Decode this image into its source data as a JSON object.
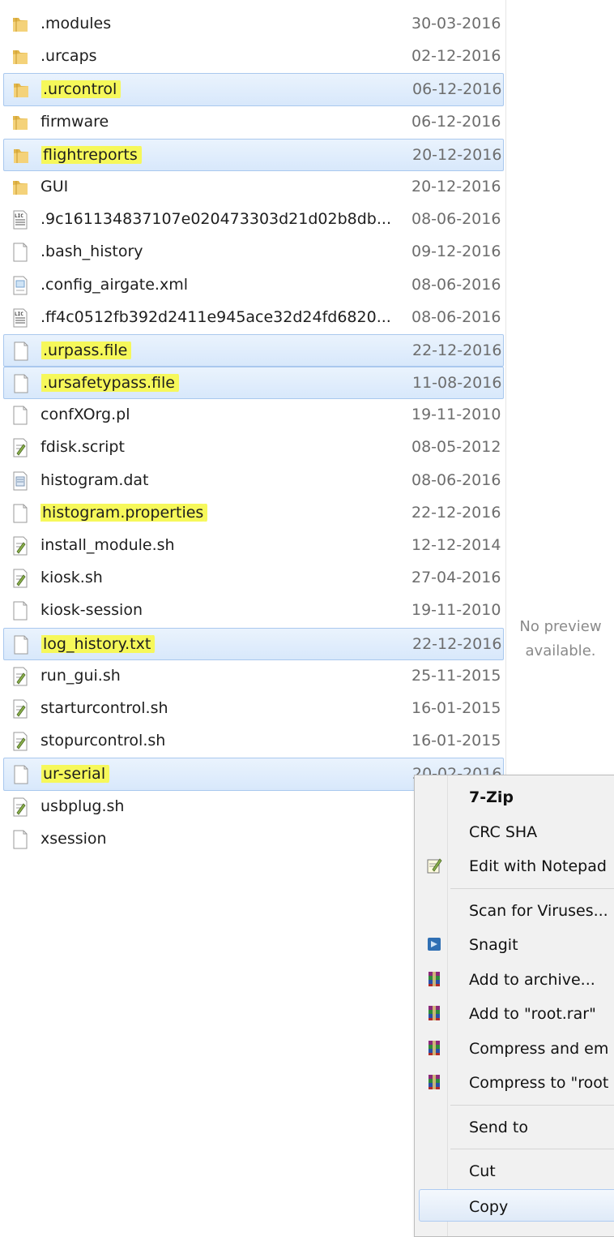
{
  "files": [
    {
      "name": ".modules",
      "date": "30-03-2016",
      "icon": "folder-icon",
      "selected": false,
      "highlighted": false
    },
    {
      "name": ".urcaps",
      "date": "02-12-2016",
      "icon": "folder-icon",
      "selected": false,
      "highlighted": false
    },
    {
      "name": ".urcontrol",
      "date": "06-12-2016",
      "icon": "folder-icon",
      "selected": true,
      "highlighted": true
    },
    {
      "name": "firmware",
      "date": "06-12-2016",
      "icon": "folder-icon",
      "selected": false,
      "highlighted": false
    },
    {
      "name": "flightreports",
      "date": "20-12-2016",
      "icon": "folder-icon",
      "selected": true,
      "highlighted": true
    },
    {
      "name": "GUI",
      "date": "20-12-2016",
      "icon": "folder-icon",
      "selected": false,
      "highlighted": false
    },
    {
      "name": ".9c161134837107e020473303d21d02b8db...",
      "date": "08-06-2016",
      "icon": "license-file-icon",
      "selected": false,
      "highlighted": false
    },
    {
      "name": ".bash_history",
      "date": "09-12-2016",
      "icon": "blank-file-icon",
      "selected": false,
      "highlighted": false
    },
    {
      "name": ".config_airgate.xml",
      "date": "08-06-2016",
      "icon": "xml-file-icon",
      "selected": false,
      "highlighted": false
    },
    {
      "name": ".ff4c0512fb392d2411e945ace32d24fd6820...",
      "date": "08-06-2016",
      "icon": "license-file-icon",
      "selected": false,
      "highlighted": false
    },
    {
      "name": ".urpass.file",
      "date": "22-12-2016",
      "icon": "blank-file-icon",
      "selected": true,
      "highlighted": true
    },
    {
      "name": ".ursafetypass.file",
      "date": "11-08-2016",
      "icon": "blank-file-icon",
      "selected": true,
      "highlighted": true
    },
    {
      "name": "confXOrg.pl",
      "date": "19-11-2010",
      "icon": "blank-file-icon",
      "selected": false,
      "highlighted": false
    },
    {
      "name": "fdisk.script",
      "date": "08-05-2012",
      "icon": "script-file-icon",
      "selected": false,
      "highlighted": false
    },
    {
      "name": "histogram.dat",
      "date": "08-06-2016",
      "icon": "data-file-icon",
      "selected": false,
      "highlighted": false
    },
    {
      "name": "histogram.properties",
      "date": "22-12-2016",
      "icon": "blank-file-icon",
      "selected": false,
      "highlighted": true
    },
    {
      "name": "install_module.sh",
      "date": "12-12-2014",
      "icon": "script-file-icon",
      "selected": false,
      "highlighted": false
    },
    {
      "name": "kiosk.sh",
      "date": "27-04-2016",
      "icon": "script-file-icon",
      "selected": false,
      "highlighted": false
    },
    {
      "name": "kiosk-session",
      "date": "19-11-2010",
      "icon": "blank-file-icon",
      "selected": false,
      "highlighted": false
    },
    {
      "name": "log_history.txt",
      "date": "22-12-2016",
      "icon": "blank-file-icon",
      "selected": true,
      "highlighted": true
    },
    {
      "name": "run_gui.sh",
      "date": "25-11-2015",
      "icon": "script-file-icon",
      "selected": false,
      "highlighted": false
    },
    {
      "name": "starturcontrol.sh",
      "date": "16-01-2015",
      "icon": "script-file-icon",
      "selected": false,
      "highlighted": false
    },
    {
      "name": "stopurcontrol.sh",
      "date": "16-01-2015",
      "icon": "script-file-icon",
      "selected": false,
      "highlighted": false
    },
    {
      "name": "ur-serial",
      "date": "20-02-2016",
      "icon": "blank-file-icon",
      "selected": true,
      "highlighted": true
    },
    {
      "name": "usbplug.sh",
      "date": "",
      "icon": "script-file-icon",
      "selected": false,
      "highlighted": false
    },
    {
      "name": "xsession",
      "date": "",
      "icon": "blank-file-icon",
      "selected": false,
      "highlighted": false
    }
  ],
  "preview": {
    "line1": "No preview",
    "line2": "available."
  },
  "context_menu": {
    "items": [
      {
        "label": "7-Zip",
        "icon": "",
        "bold": true
      },
      {
        "label": "CRC SHA",
        "icon": ""
      },
      {
        "label": "Edit with Notepad",
        "icon": "notepad-icon"
      },
      {
        "separator": true
      },
      {
        "label": "Scan for Viruses...",
        "icon": ""
      },
      {
        "label": "Snagit",
        "icon": "snagit-icon"
      },
      {
        "label": "Add to archive...",
        "icon": "winrar-icon"
      },
      {
        "label": "Add to \"root.rar\"",
        "icon": "winrar-icon"
      },
      {
        "label": "Compress and em",
        "icon": "winrar-icon"
      },
      {
        "label": "Compress to \"root",
        "icon": "winrar-icon"
      },
      {
        "separator": true
      },
      {
        "label": "Send to",
        "icon": ""
      },
      {
        "separator": true
      },
      {
        "label": "Cut",
        "icon": ""
      },
      {
        "label": "Copy",
        "icon": "",
        "hover": true
      }
    ]
  },
  "colors": {
    "highlight": "#f6f85a",
    "selection": "#d8e8fb",
    "date_text": "#6d6d6d"
  }
}
